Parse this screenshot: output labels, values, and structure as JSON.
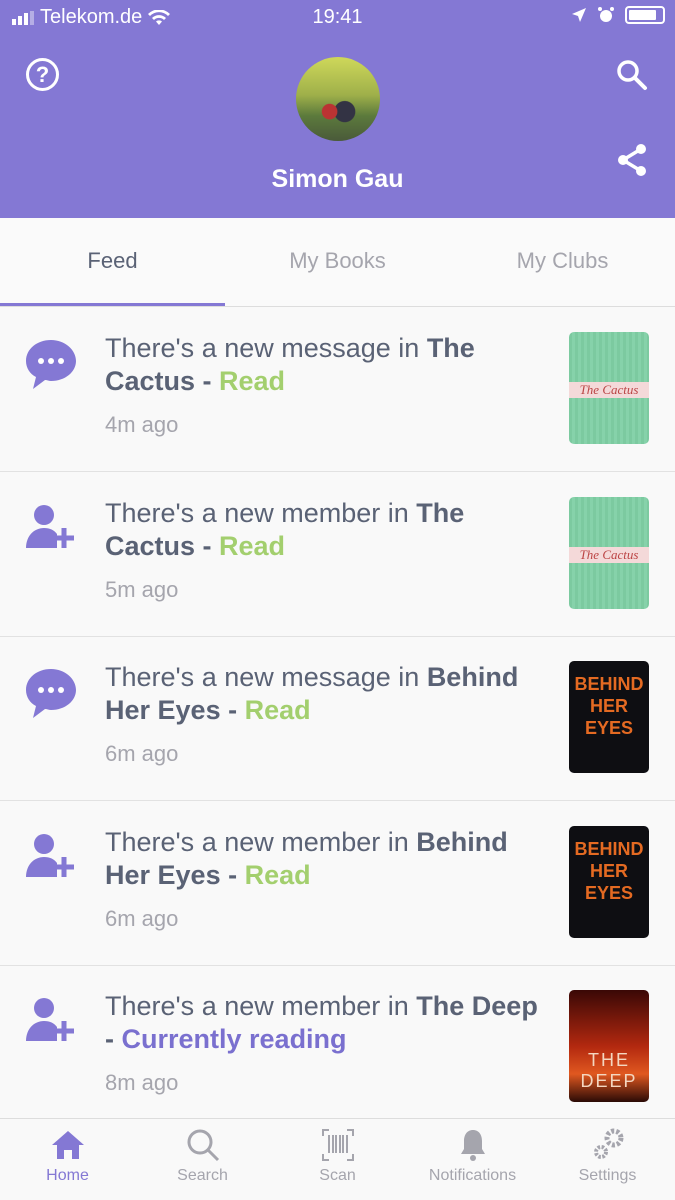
{
  "status_bar": {
    "carrier": "Telekom.de",
    "time": "19:41"
  },
  "header": {
    "user_name": "Simon Gau",
    "accent_color": "#8478d4"
  },
  "tabs": [
    {
      "label": "Feed",
      "active": true
    },
    {
      "label": "My Books",
      "active": false
    },
    {
      "label": "My Clubs",
      "active": false
    }
  ],
  "feed": [
    {
      "icon": "chat-bubble-icon",
      "prefix": "There's a new message in ",
      "book": "The Cactus",
      "sep": " - ",
      "status": "Read",
      "status_color": "#a3cf6e",
      "time": "4m ago",
      "cover": "The Cactus"
    },
    {
      "icon": "add-user-icon",
      "prefix": "There's a new member in ",
      "book": "The Cactus",
      "sep": " - ",
      "status": "Read",
      "status_color": "#a3cf6e",
      "time": "5m ago",
      "cover": "The Cactus"
    },
    {
      "icon": "chat-bubble-icon",
      "prefix": "There's a new message in ",
      "book": "Behind Her Eyes",
      "sep": " - ",
      "status": "Read",
      "status_color": "#a3cf6e",
      "time": "6m ago",
      "cover": "BEHIND HER EYES"
    },
    {
      "icon": "add-user-icon",
      "prefix": "There's a new member in ",
      "book": "Behind Her Eyes",
      "sep": " - ",
      "status": "Read",
      "status_color": "#a3cf6e",
      "time": "6m ago",
      "cover": "BEHIND HER EYES"
    },
    {
      "icon": "add-user-icon",
      "prefix": "There's a new member in ",
      "book": "The Deep",
      "sep": " - ",
      "status": "Currently reading",
      "status_color": "#7a70cf",
      "time": "8m ago",
      "cover": "THE DEEP"
    }
  ],
  "tabbar": [
    {
      "label": "Home",
      "active": true
    },
    {
      "label": "Search"
    },
    {
      "label": "Scan"
    },
    {
      "label": "Notifications"
    },
    {
      "label": "Settings"
    }
  ]
}
